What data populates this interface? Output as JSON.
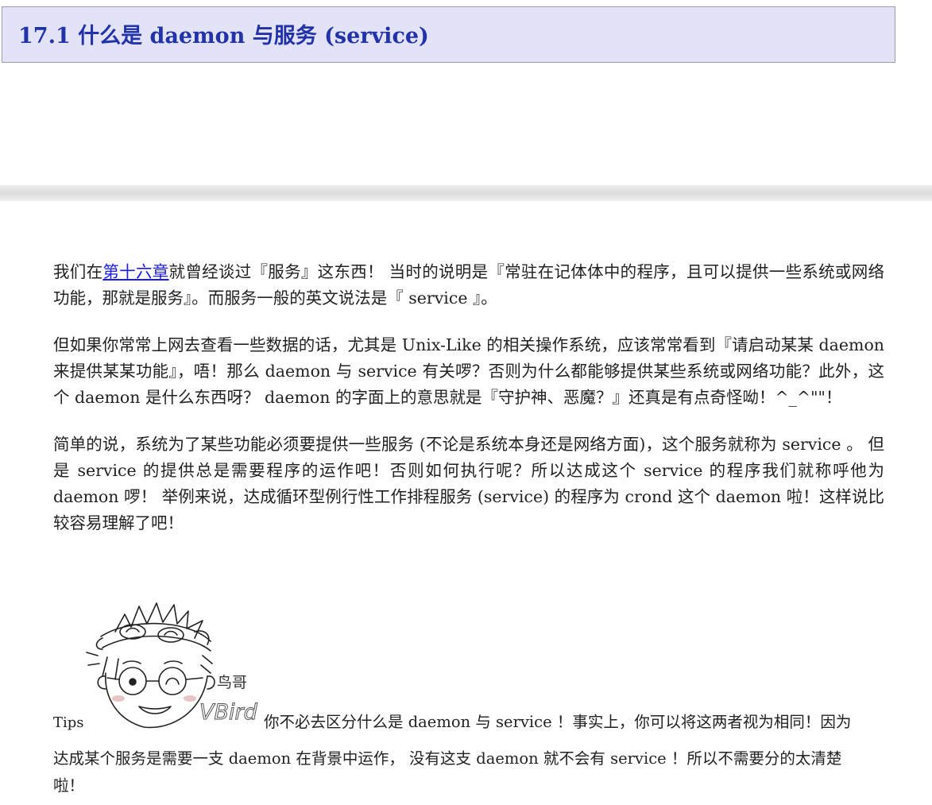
{
  "section": {
    "title": "17.1  什么是  daemon  与服务  (service)"
  },
  "paragraphs": {
    "p1_before_link": "我们在",
    "p1_link": "第十六章",
    "p1_after_link": "就曾经谈过『服务』这东西！ 当时的说明是『常驻在记体体中的程序，且可以提供一些系统或网络功能，那就是服务』。而服务一般的英文说法是『 service 』。",
    "p2": "但如果你常常上网去查看一些数据的话，尤其是 Unix-Like 的相关操作系统，应该常常看到『请启动某某 daemon 来提供某某功能』，唔！那么 daemon 与 service 有关啰？否则为什么都能够提供某些系统或网络功能？此外，这个 daemon 是什么东西呀？ daemon 的字面上的意思就是『守护神、恶魔？』还真是有点奇怪呦！^_^\"\"！",
    "p3": "简单的说，系统为了某些功能必须要提供一些服务 (不论是系统本身还是网络方面)，这个服务就称为 service 。 但是 service 的提供总是需要程序的运作吧！否则如何执行呢？所以达成这个 service 的程序我们就称呼他为 daemon 啰！ 举例来说，达成循环型例行性工作排程服务 (service) 的程序为 crond 这个 daemon 啦！这样说比较容易理解了吧！"
  },
  "tips": {
    "label": "Tips",
    "figure_caption_cn": "鸟哥",
    "figure_caption_en": "VBird",
    "line1": "你不必去区分什么是 daemon 与 service ！事实上，你可以将这两者视为相同！因为",
    "line2": "达成某个服务是需要一支 daemon 在背景中运作， 没有这支 daemon 就不会有 service ！所以不需要分的太清楚",
    "line3": "啦！"
  },
  "colors": {
    "title_text": "#2232a8",
    "title_background": "#e3e3f8",
    "link": "#1a1aee"
  }
}
